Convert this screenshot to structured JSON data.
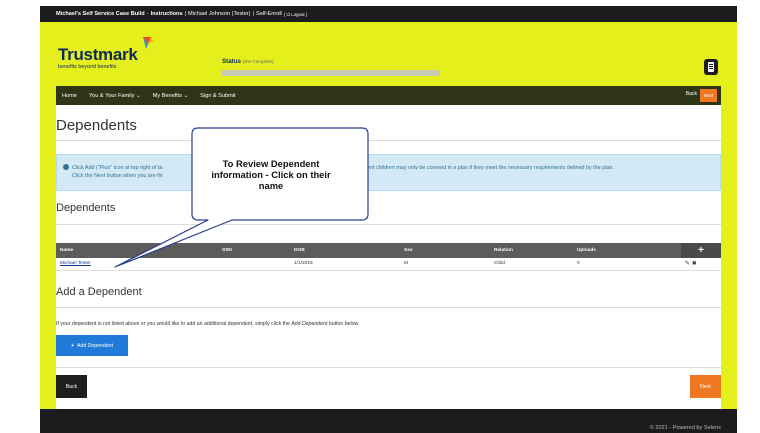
{
  "topbar": {
    "app_title": "Michael's Self Service Case Build",
    "sep1": "-",
    "instructions": "Instructions",
    "sep2": "|",
    "user": "Michael Johnson (Tester)",
    "sep3": "|",
    "enroll": "Self-Enroll",
    "logout": "( ⏻ Logout )"
  },
  "header": {
    "logo_word": "Trustmark",
    "logo_tag": "benefits beyond benefits",
    "status_label": "Status",
    "status_pct": "(0% Complete)",
    "progress": 0,
    "doc_icon": "document-icon"
  },
  "nav": {
    "items": [
      "Home",
      "You & Your Family ⌄",
      "My Benefits ⌄",
      "Sign & Submit"
    ],
    "back": "Back",
    "next": "Next"
  },
  "page": {
    "title": "Dependents",
    "info_line1_left": "Click Add (\"Plus\" icon at top right of ta",
    "info_line1_right": "ent children may only be covered in a plan if they meet the necessary requirements defined by the plan.",
    "info_line2": "Click the Next button when you are fin",
    "section_title": "Dependents",
    "add_title": "Add a Dependent",
    "intro_before": "If your dependent is not listed above or you would like to add an additional dependent, simply click the ",
    "intro_em": "Add Dependent",
    "intro_after": " button below.",
    "add_button": "Add Dependent",
    "back_button": "Back",
    "next_button": "Next"
  },
  "table": {
    "columns": [
      "Name",
      "SSN",
      "DOB",
      "Sex",
      "Relation",
      "Uploads"
    ],
    "add_icon": "+",
    "rows": [
      {
        "name": "Michael Tester",
        "ssn": "",
        "dob": "1/1/2015",
        "sex": "M",
        "relation": "Child",
        "uploads": "0",
        "actions": "✎ ✖"
      }
    ]
  },
  "callout": {
    "line1": "To Review Dependent",
    "line2": "information - Click on their",
    "line3": "name"
  },
  "footer": {
    "text": "© 2021 - Powered by Selerix"
  },
  "colors": {
    "accent_yellow": "#e4ef1b",
    "nav_green": "#2f3618",
    "orange": "#f07820",
    "blue": "#1f7ad8",
    "info_bg": "#d3e9f6"
  }
}
